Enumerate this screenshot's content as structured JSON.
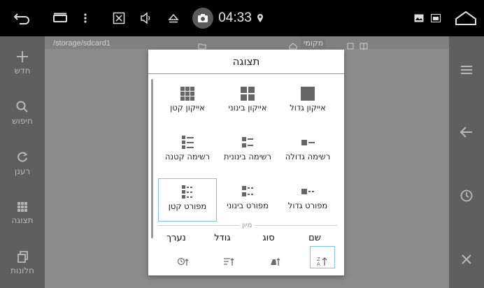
{
  "status": {
    "time": "04:33",
    "icons": [
      "back-arrow-icon",
      "recents-icon",
      "more-dots-icon",
      "close-box-icon",
      "volume-icon",
      "eject-icon",
      "camera-icon",
      "location-icon",
      "gallery-icon",
      "image-icon",
      "home-icon"
    ]
  },
  "file_manager": {
    "path": "/storage/sdcard1",
    "tab_label": "מקומי",
    "left_rail": [
      {
        "label": "חדש",
        "icon": "plus-icon"
      },
      {
        "label": "חיפוש",
        "icon": "search-icon"
      },
      {
        "label": "רענן",
        "icon": "refresh-icon"
      },
      {
        "label": "תצוגה",
        "icon": "grid-icon"
      },
      {
        "label": "חלונות",
        "icon": "windows-icon"
      }
    ],
    "right_rail": [
      "menu-icon",
      "back-icon",
      "history-icon",
      "close-icon"
    ]
  },
  "dialog": {
    "title": "תצוגה",
    "view_options": [
      {
        "label": "אייקון גדול",
        "icon": "large-icon-glyph",
        "selected": false
      },
      {
        "label": "אייקון בינוני",
        "icon": "medium-icon-glyph",
        "selected": false
      },
      {
        "label": "אייקון קטן",
        "icon": "small-icon-glyph",
        "selected": false
      },
      {
        "label": "רשימה גדולה",
        "icon": "large-list-glyph",
        "selected": false
      },
      {
        "label": "רשימה בינונית",
        "icon": "medium-list-glyph",
        "selected": false
      },
      {
        "label": "רשימה קטנה",
        "icon": "small-list-glyph",
        "selected": false
      },
      {
        "label": "מפורט גדול",
        "icon": "large-detail-glyph",
        "selected": false
      },
      {
        "label": "מפורט בינוני",
        "icon": "medium-detail-glyph",
        "selected": false
      },
      {
        "label": "מפורט קטן",
        "icon": "small-detail-glyph",
        "selected": true
      }
    ],
    "sort_label": "מיון",
    "sort_options": [
      {
        "label": "שם",
        "icon": "sort-az-icon",
        "selected": true
      },
      {
        "label": "סוג",
        "icon": "sort-type-icon",
        "selected": false
      },
      {
        "label": "גודל",
        "icon": "sort-size-icon",
        "selected": false
      },
      {
        "label": "נערך",
        "icon": "sort-date-icon",
        "selected": false
      }
    ]
  },
  "colors": {
    "accent": "#4aa7d8",
    "selection_border": "#7fc3ea",
    "rail_bg": "#5f5f5f",
    "content_bg": "#8a8a8a"
  }
}
